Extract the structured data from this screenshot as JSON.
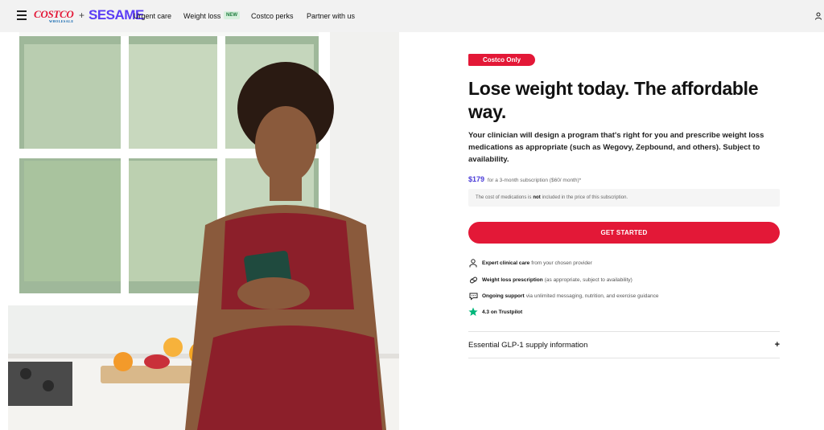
{
  "header": {
    "brand_costco": "COSTCO",
    "brand_costco_sub": "WHOLESALE",
    "brand_plus": "+",
    "brand_sesame": "SESAME",
    "nav": [
      {
        "label": "Urgent care"
      },
      {
        "label": "Weight loss",
        "badge": "NEW"
      },
      {
        "label": "Costco perks"
      },
      {
        "label": "Partner with us"
      }
    ]
  },
  "hero": {
    "image_alt": "Smiling woman holding phone in kitchen"
  },
  "content": {
    "badge": "Costco Only",
    "headline": "Lose weight today. The affordable way.",
    "description": "Your clinician will design a program that's right for you and prescribe weight loss medications as appropriate (such as Wegovy, Zepbound, and others). Subject to availability.",
    "price": "$179",
    "price_detail": "for a 3-month subscription ($60/ month)*",
    "note_pre": "The cost of medications is",
    "note_bold": "not",
    "note_post": "included in the price of this subscription.",
    "cta": "GET STARTED",
    "features": [
      {
        "icon": "clinician-icon",
        "bold": "Expert clinical care",
        "text": "from your chosen provider"
      },
      {
        "icon": "pill-icon",
        "bold": "Weight loss prescription",
        "text": "(as appropriate, subject to availability)"
      },
      {
        "icon": "chat-icon",
        "bold": "Ongoing support",
        "text": "via unlimited messaging, nutrition, and exercise guidance"
      },
      {
        "icon": "star-icon",
        "bold": "4.3 on Trustpilot",
        "text": ""
      }
    ],
    "accordion_label": "Essential GLP-1 supply information",
    "accordion_icon": "+"
  },
  "colors": {
    "brand_red": "#e31837",
    "sesame_purple": "#5b3df5",
    "price_purple": "#4a3bd8",
    "trustpilot_green": "#00b67a"
  }
}
